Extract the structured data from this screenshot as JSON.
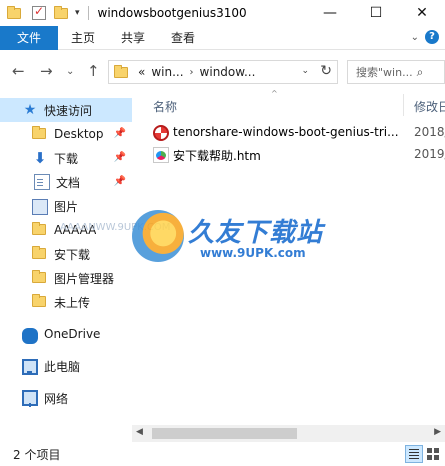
{
  "window": {
    "title": "windowsbootgenius3100",
    "qa_pin": "▾",
    "minimize": "—",
    "maximize": "☐",
    "close": "✕"
  },
  "ribbon": {
    "tabs": [
      "文件",
      "主页",
      "共享",
      "查看"
    ],
    "expand": "⌄",
    "help": "?"
  },
  "address": {
    "back": "←",
    "forward": "→",
    "recent": "⌄",
    "up": "↑",
    "overflow": "«",
    "crumbs": [
      "win...",
      "window..."
    ],
    "chev": "›",
    "dropdown": "⌄",
    "refresh": "↻"
  },
  "search": {
    "placeholder": "搜索\"win...",
    "icon": "⌕"
  },
  "navigation": {
    "items": [
      {
        "label": "快速访问",
        "icon": "star-icon",
        "pinned": false
      },
      {
        "label": "Desktop",
        "icon": "folder-icon",
        "pinned": true
      },
      {
        "label": "下载",
        "icon": "download-arrow-icon",
        "pinned": true
      },
      {
        "label": "文档",
        "icon": "document-icon",
        "pinned": true
      },
      {
        "label": "图片",
        "icon": "pictures-icon",
        "pinned": false
      },
      {
        "label": "AAAAA",
        "icon": "folder-icon",
        "pinned": false
      },
      {
        "label": "安下载",
        "icon": "folder-icon",
        "pinned": false
      },
      {
        "label": "图片管理器",
        "icon": "folder-icon",
        "pinned": false
      },
      {
        "label": "未上传",
        "icon": "folder-icon",
        "pinned": false
      },
      {
        "label": "OneDrive",
        "icon": "cloud-icon",
        "pinned": false
      },
      {
        "label": "此电脑",
        "icon": "computer-icon",
        "pinned": false
      },
      {
        "label": "网络",
        "icon": "network-icon",
        "pinned": false
      }
    ],
    "pin_glyph": "📌"
  },
  "columns": {
    "name": "名称",
    "date": "修改日",
    "sort": "^"
  },
  "files": [
    {
      "name": "tenorshare-windows-boot-genius-tri...",
      "date": "2018/",
      "icon": "exe-icon"
    },
    {
      "name": "安下载帮助.htm",
      "date": "2019/",
      "icon": "htm-icon"
    }
  ],
  "watermark": {
    "title": "久友下载站",
    "url": "www.9UPK.com",
    "faint": "AAAANWW.9UPK.COM"
  },
  "scrollbar": {
    "left": "◀",
    "right": "▶"
  },
  "status": {
    "count": "2 个项目"
  },
  "colors": {
    "accent": "#1979ca",
    "selection": "#cce8ff"
  }
}
